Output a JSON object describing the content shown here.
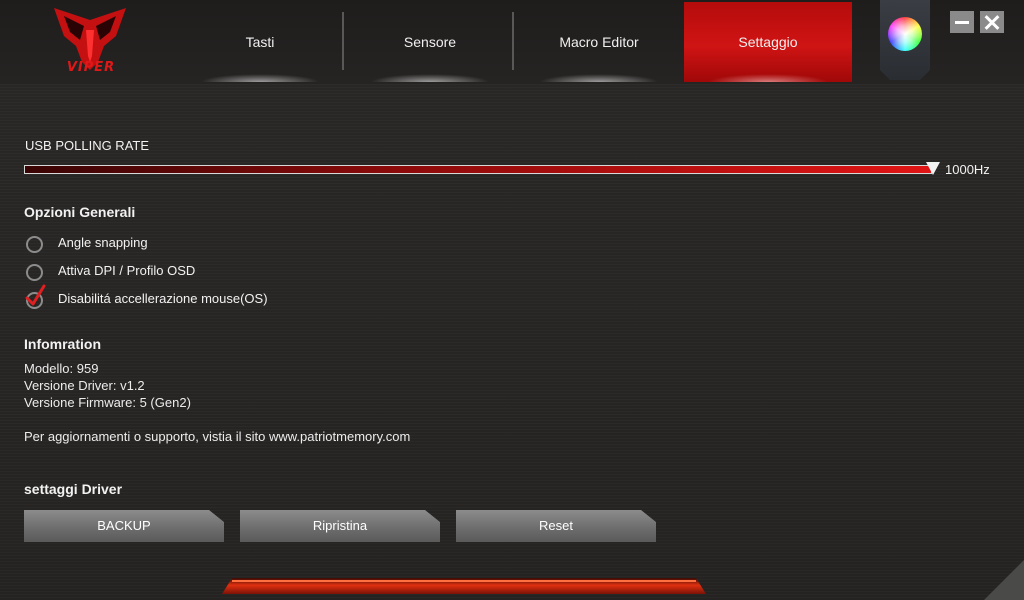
{
  "brand": {
    "logo_text": "VIPER"
  },
  "tabs": [
    {
      "label": "Tasti"
    },
    {
      "label": "Sensore"
    },
    {
      "label": "Macro Editor"
    },
    {
      "label": "Settaggio",
      "active": true
    }
  ],
  "window_controls": {
    "minimize_icon": "minimize-icon",
    "close_icon": "close-icon",
    "color_icon": "color-wheel-icon"
  },
  "polling": {
    "label": "USB POLLING RATE",
    "value_text": "1000Hz",
    "fraction": 1.0
  },
  "options": {
    "heading": "Opzioni Generali",
    "items": [
      {
        "label": "Angle snapping",
        "checked": false
      },
      {
        "label": "Attiva DPI / Profilo OSD",
        "checked": false
      },
      {
        "label": "Disabilitá accellerazione mouse(OS)",
        "checked": true
      }
    ]
  },
  "info": {
    "heading": "Infomration",
    "model": "Modello: 959",
    "driver": "Versione Driver: v1.2",
    "firmware": "Versione Firmware: 5 (Gen2)",
    "support": "Per aggiornamenti o supporto, vistia il sito www.patriotmemory.com"
  },
  "driver": {
    "heading": "settaggi Driver",
    "backup_label": "BACKUP",
    "restore_label": "Ripristina",
    "reset_label": "Reset"
  },
  "colors": {
    "accent": "#d01414",
    "button": "#7a7a7a"
  }
}
